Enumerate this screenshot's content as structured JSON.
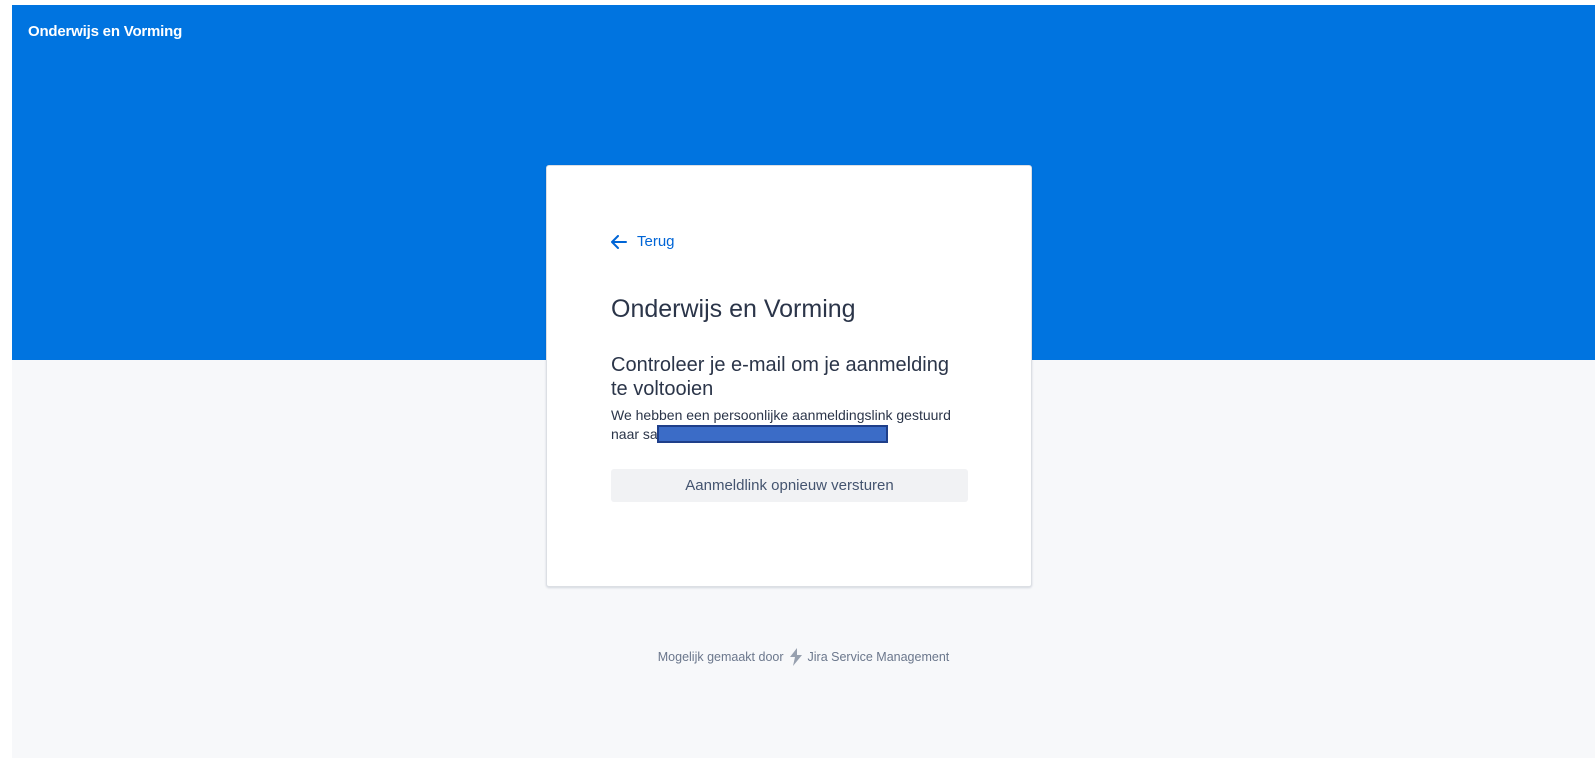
{
  "header": {
    "portal_name": "Onderwijs en Vorming"
  },
  "card": {
    "back_label": "Terug",
    "back_icon": "arrow-left-icon",
    "title": "Onderwijs en Vorming",
    "heading": "Controleer je e-mail om je aanmelding te voltooien",
    "body_line1": "We hebben een persoonlijke aanmeldingslink gestuurd",
    "body_prefix": "naar sa",
    "resend_label": "Aanmeldlink opnieuw versturen"
  },
  "footer": {
    "powered_by": "Mogelijk gemaakt door",
    "product_icon": "jira-service-management-icon",
    "product_name": "Jira Service Management"
  },
  "colors": {
    "banner": "#0074e0",
    "link": "#0065d6",
    "text": "#2b3549",
    "page_bg": "#f7f8fa"
  }
}
